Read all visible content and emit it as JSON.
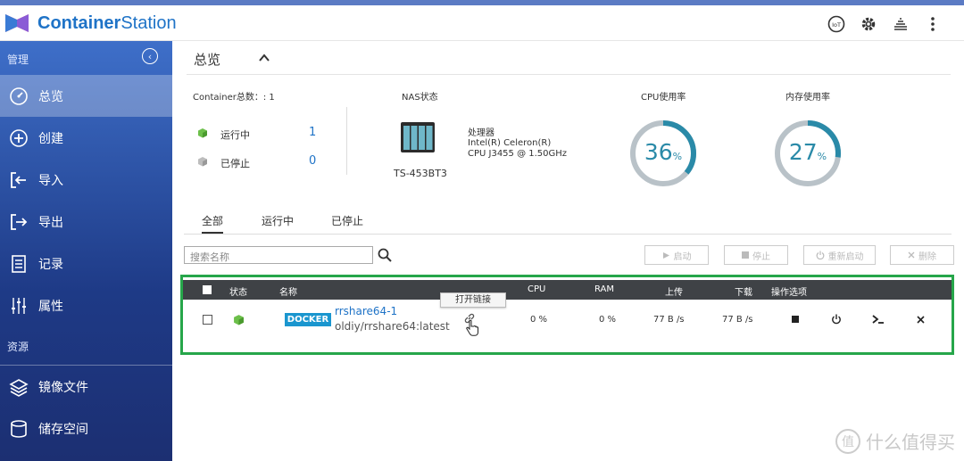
{
  "app": {
    "title_part1": "Container",
    "title_part2": "Station"
  },
  "header_icons": [
    "iot-icon",
    "gear-icon",
    "stack-icon",
    "more-vertical-icon"
  ],
  "header": {
    "iot_label": "IoT"
  },
  "sidebar": {
    "section_manage": "管理",
    "items": [
      {
        "label": "总览",
        "icon": "dashboard-icon",
        "active": true
      },
      {
        "label": "创建",
        "icon": "plus-circle-icon"
      },
      {
        "label": "导入",
        "icon": "import-icon"
      },
      {
        "label": "导出",
        "icon": "export-icon"
      },
      {
        "label": "记录",
        "icon": "document-icon"
      },
      {
        "label": "属性",
        "icon": "sliders-icon"
      }
    ],
    "section_resources": "资源",
    "resource_items": [
      {
        "label": "镜像文件",
        "icon": "layers-icon"
      },
      {
        "label": "储存空间",
        "icon": "storage-icon"
      }
    ]
  },
  "main": {
    "title": "总览",
    "container_total_label": "Container总数：: 1",
    "running_label": "运行中",
    "running_count": "1",
    "stopped_label": "已停止",
    "stopped_count": "0",
    "nas_status_label": "NAS状态",
    "nas_model": "TS-453BT3",
    "processor_label": "处理器",
    "processor_line1": "Intel(R) Celeron(R)",
    "processor_line2": "CPU J3455 @ 1.50GHz",
    "cpu_usage_label": "CPU使用率",
    "cpu_usage_value": "36",
    "cpu_usage_fraction": 0.36,
    "mem_usage_label": "内存使用率",
    "mem_usage_value": "27",
    "mem_usage_fraction": 0.27,
    "percent_sign": "%",
    "tabs": [
      {
        "label": "全部",
        "active": true
      },
      {
        "label": "运行中"
      },
      {
        "label": "已停止"
      }
    ],
    "search_placeholder": "搜索名称",
    "actions": [
      {
        "label": "启动",
        "icon": "play-icon"
      },
      {
        "label": "停止",
        "icon": "stop-icon"
      },
      {
        "label": "重新启动",
        "icon": "power-icon"
      },
      {
        "label": "删除",
        "icon": "close-icon"
      }
    ],
    "table": {
      "columns": [
        "状态",
        "名称",
        "CPU",
        "RAM",
        "上传",
        "下载",
        "操作选项"
      ],
      "rows": [
        {
          "badge": "DOCKER",
          "name": "rrshare64-1",
          "image": "oldiy/rrshare64:latest",
          "cpu": "0 %",
          "ram": "0 %",
          "upload": "77 B /s",
          "download": "77 B /s"
        }
      ]
    },
    "tooltip": "打开链接"
  },
  "watermark": {
    "glyph": "值",
    "text": "什么值得买"
  },
  "colors": {
    "accent": "#1f73c7",
    "gauge": "#2a8aa8",
    "highlight_border": "#26a64a",
    "table_header": "#3f4246"
  }
}
